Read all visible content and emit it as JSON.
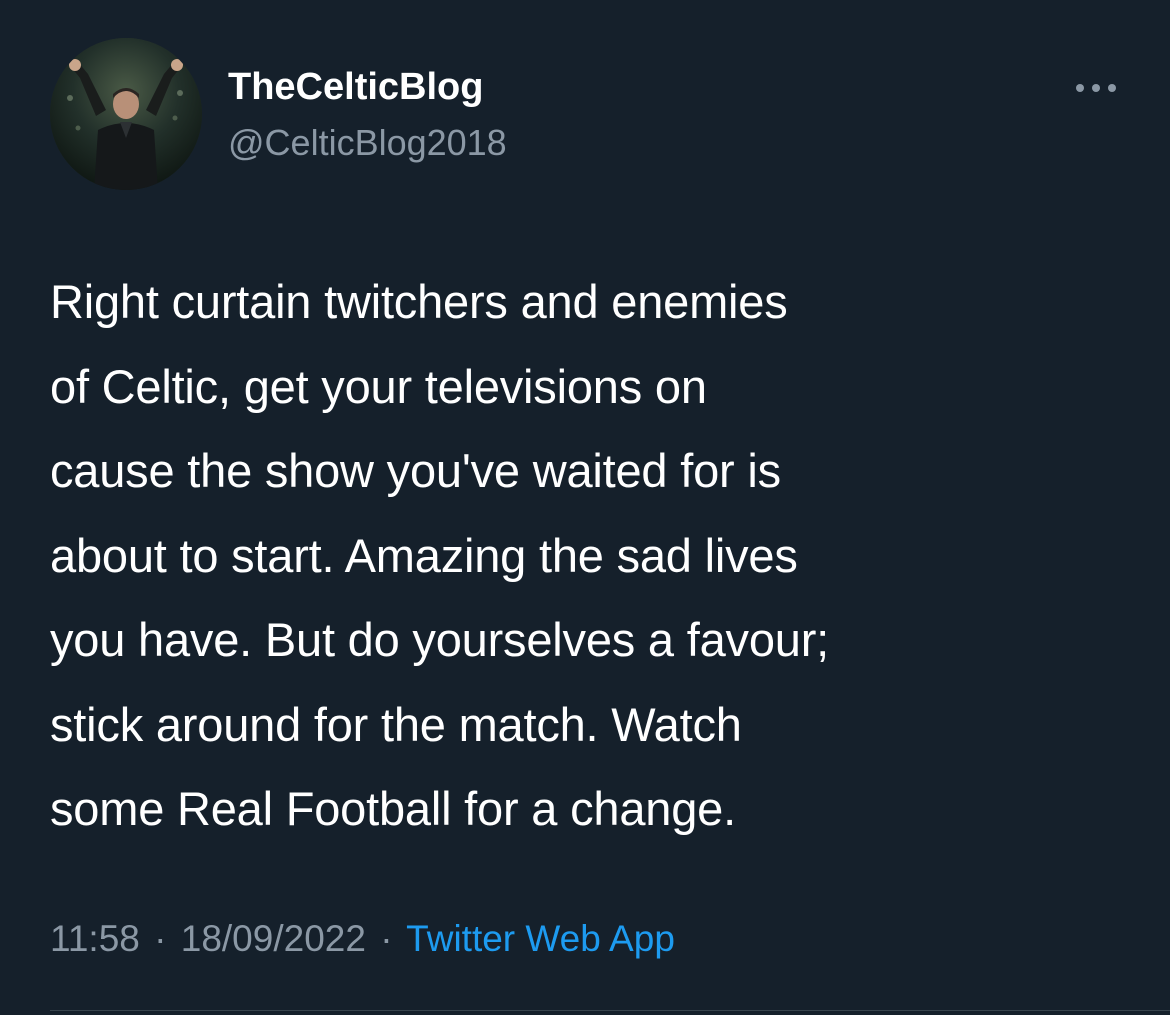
{
  "tweet": {
    "author": {
      "display_name": "TheCelticBlog",
      "handle": "@CelticBlog2018",
      "avatar_icon": "profile-photo-icon"
    },
    "more_icon": "ellipsis-icon",
    "text_lines": [
      "Right curtain twitchers and enemies",
      "of Celtic, get your televisions on",
      "cause the show you've waited for is",
      "about to start. Amazing the sad lives",
      "you have. But do yourselves a favour;",
      "stick around for the match. Watch",
      "some Real Football for a change."
    ],
    "meta": {
      "time": "11:58",
      "separator": "·",
      "date": "18/09/2022",
      "source": "Twitter Web App"
    }
  },
  "colors": {
    "background": "#15202b",
    "primary_text": "#ffffff",
    "secondary_text": "#8b98a5",
    "link": "#1d9bf0",
    "divider": "#38444d"
  }
}
